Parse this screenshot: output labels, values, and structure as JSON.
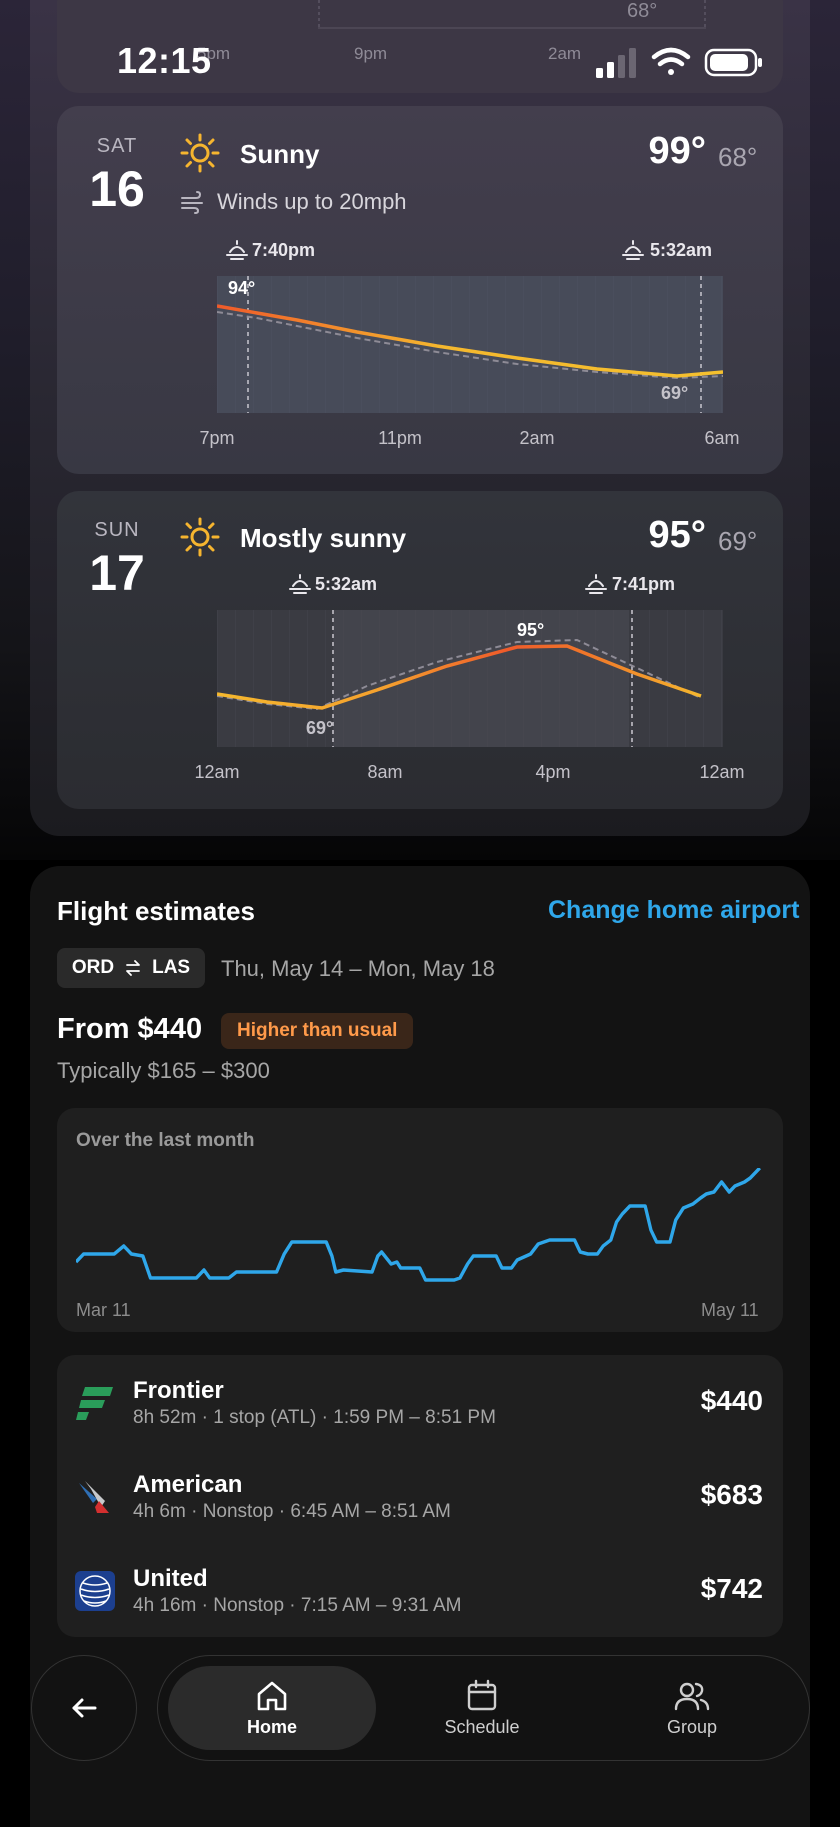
{
  "status": {
    "time": "12:15"
  },
  "previous_card": {
    "ticks": [
      "5pm",
      "9pm",
      "2am"
    ],
    "low_label": "68°"
  },
  "days": [
    {
      "day": "SAT",
      "date": "16",
      "condition": "Sunny",
      "wind": "Winds up to 20mph",
      "high": "99°",
      "low": "68°",
      "sun_events": [
        "7:40pm",
        "5:32am"
      ],
      "chart_labels": {
        "max": "94°",
        "min": "69°"
      },
      "axis": [
        "7pm",
        "11pm",
        "2am",
        "6am"
      ]
    },
    {
      "day": "SUN",
      "date": "17",
      "condition": "Mostly sunny",
      "high": "95°",
      "low": "69°",
      "sun_events": [
        "5:32am",
        "7:41pm"
      ],
      "chart_labels": {
        "max": "95°",
        "min": "69°"
      },
      "axis": [
        "12am",
        "8am",
        "4pm",
        "12am"
      ]
    }
  ],
  "flights": {
    "title": "Flight estimates",
    "change_link": "Change home airport",
    "route": {
      "from": "ORD",
      "to": "LAS",
      "swap_icon": "swap-arrows-icon"
    },
    "dates": "Thu, May 14 – Mon, May 18",
    "from_price": "From $440",
    "badge": "Higher than usual",
    "typical": "Typically $165 – $300",
    "history": {
      "title": "Over the last month",
      "start": "Mar 11",
      "end": "May 11"
    },
    "options": [
      {
        "airline": "Frontier",
        "details": "8h 52m · 1 stop (ATL) · 1:59 PM – 8:51 PM",
        "price": "$440"
      },
      {
        "airline": "American",
        "details": "4h 6m · Nonstop · 6:45 AM – 8:51 AM",
        "price": "$683"
      },
      {
        "airline": "United",
        "details": "4h 16m · Nonstop · 7:15 AM – 9:31 AM",
        "price": "$742"
      }
    ]
  },
  "nav": {
    "items": [
      {
        "label": "Home",
        "icon": "home-icon"
      },
      {
        "label": "Schedule",
        "icon": "calendar-icon"
      },
      {
        "label": "Group",
        "icon": "group-icon"
      }
    ],
    "back_icon": "back-arrow-icon"
  },
  "colors": {
    "accent": "#2fa7ea",
    "temp_hot": "#ef5a2a",
    "temp_warm": "#f5b82e",
    "badge_text": "#ff9a4a"
  }
}
